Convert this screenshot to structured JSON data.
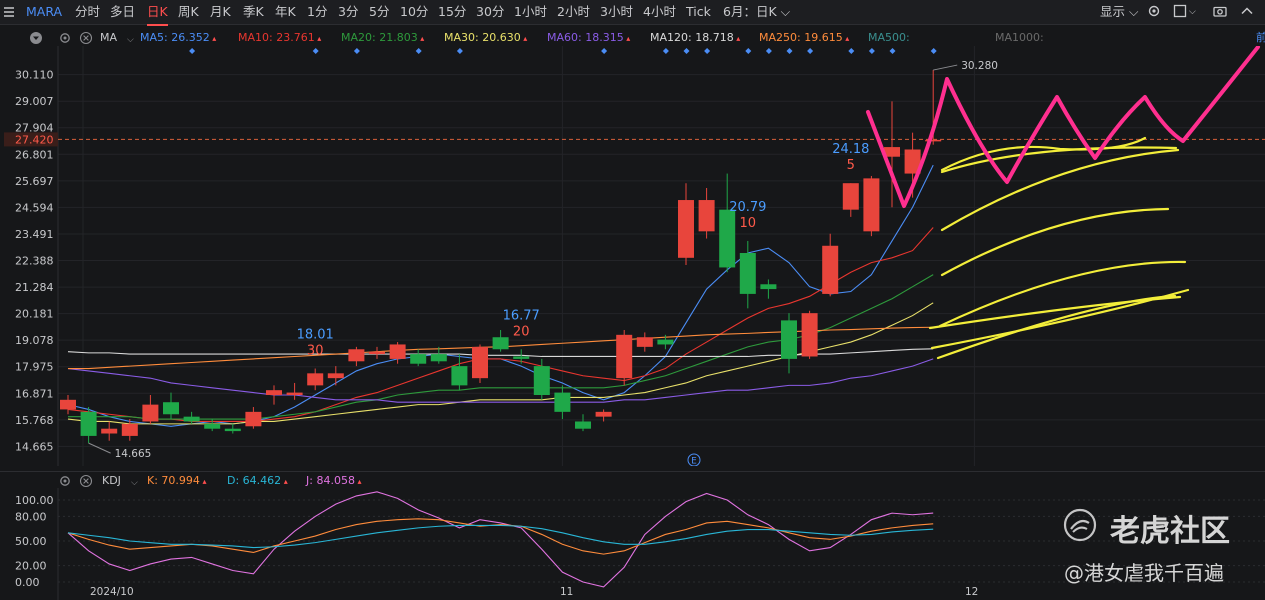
{
  "topbar": {
    "ticker": "MARA",
    "periods": [
      "分时",
      "多日",
      "日K",
      "周K",
      "月K",
      "季K",
      "年K",
      "1分",
      "3分",
      "5分",
      "10分",
      "15分",
      "30分",
      "1小时",
      "2小时",
      "3小时",
      "4小时",
      "Tick",
      "6月：日K"
    ],
    "active_period": "日K",
    "display_label": "显示"
  },
  "main_legend": {
    "indicator": "MA",
    "items": [
      {
        "label": "MA5:",
        "value": "26.352",
        "color": "#4b8df5"
      },
      {
        "label": "MA10:",
        "value": "23.761",
        "color": "#e8362f"
      },
      {
        "label": "MA20:",
        "value": "21.803",
        "color": "#2e9a3c"
      },
      {
        "label": "MA30:",
        "value": "20.630",
        "color": "#e8e06a"
      },
      {
        "label": "MA60:",
        "value": "18.315",
        "color": "#8a5ce6"
      },
      {
        "label": "MA120:",
        "value": "18.718",
        "color": "#d9d9d9"
      },
      {
        "label": "MA250:",
        "value": "19.615",
        "color": "#ff8c3c"
      },
      {
        "label": "MA500:",
        "value": "",
        "color": "#3a8f8f"
      },
      {
        "label": "MA1000:",
        "value": "",
        "color": "#6a6a6a"
      }
    ]
  },
  "kdj_legend": {
    "indicator": "KDJ",
    "items": [
      {
        "label": "K:",
        "value": "70.994",
        "color": "#ff8c3c"
      },
      {
        "label": "D:",
        "value": "64.462",
        "color": "#29b6d6"
      },
      {
        "label": "J:",
        "value": "84.058",
        "color": "#e073e0"
      }
    ]
  },
  "current_price": "27.420",
  "edge_label": "前",
  "event_marker": "E",
  "chart_data": {
    "type": "candlestick",
    "y_ticks": [
      30.11,
      29.007,
      27.904,
      26.801,
      25.697,
      24.594,
      23.491,
      22.388,
      21.284,
      20.181,
      19.078,
      17.975,
      16.871,
      15.768,
      14.665
    ],
    "y_range": [
      13.85,
      31.3
    ],
    "x_labels": [
      "2024/10",
      "11",
      "12"
    ],
    "candles": [
      {
        "o": 16.2,
        "h": 16.8,
        "l": 16.0,
        "c": 16.6
      },
      {
        "o": 16.1,
        "h": 16.3,
        "l": 14.8,
        "c": 15.1
      },
      {
        "o": 15.2,
        "h": 15.7,
        "l": 14.9,
        "c": 15.4
      },
      {
        "o": 15.1,
        "h": 15.8,
        "l": 14.9,
        "c": 15.6
      },
      {
        "o": 15.7,
        "h": 16.8,
        "l": 15.6,
        "c": 16.4
      },
      {
        "o": 16.5,
        "h": 16.9,
        "l": 15.8,
        "c": 16.0
      },
      {
        "o": 15.9,
        "h": 16.1,
        "l": 15.6,
        "c": 15.7
      },
      {
        "o": 15.6,
        "h": 15.8,
        "l": 15.3,
        "c": 15.4
      },
      {
        "o": 15.4,
        "h": 15.6,
        "l": 15.2,
        "c": 15.3
      },
      {
        "o": 15.5,
        "h": 16.3,
        "l": 15.4,
        "c": 16.1
      },
      {
        "o": 16.8,
        "h": 17.2,
        "l": 16.4,
        "c": 17.0
      },
      {
        "o": 16.8,
        "h": 17.3,
        "l": 16.6,
        "c": 16.9
      },
      {
        "o": 17.2,
        "h": 17.9,
        "l": 17.0,
        "c": 17.7
      },
      {
        "o": 17.5,
        "h": 18.0,
        "l": 17.2,
        "c": 17.7
      },
      {
        "o": 18.2,
        "h": 18.8,
        "l": 18.0,
        "c": 18.7
      },
      {
        "o": 18.5,
        "h": 18.8,
        "l": 18.3,
        "c": 18.6
      },
      {
        "o": 18.3,
        "h": 19.0,
        "l": 18.1,
        "c": 18.9
      },
      {
        "o": 18.5,
        "h": 18.7,
        "l": 18.0,
        "c": 18.1
      },
      {
        "o": 18.5,
        "h": 18.8,
        "l": 18.1,
        "c": 18.2
      },
      {
        "o": 18.0,
        "h": 18.5,
        "l": 17.0,
        "c": 17.2
      },
      {
        "o": 17.5,
        "h": 18.9,
        "l": 17.3,
        "c": 18.8
      },
      {
        "o": 19.2,
        "h": 19.5,
        "l": 18.6,
        "c": 18.7
      },
      {
        "o": 18.4,
        "h": 18.7,
        "l": 18.1,
        "c": 18.3
      },
      {
        "o": 18.0,
        "h": 18.3,
        "l": 16.6,
        "c": 16.8
      },
      {
        "o": 16.9,
        "h": 17.2,
        "l": 15.8,
        "c": 16.1
      },
      {
        "o": 15.7,
        "h": 16.0,
        "l": 15.3,
        "c": 15.4
      },
      {
        "o": 15.9,
        "h": 16.2,
        "l": 15.7,
        "c": 16.1
      },
      {
        "o": 17.5,
        "h": 19.5,
        "l": 17.2,
        "c": 19.3
      },
      {
        "o": 18.8,
        "h": 19.4,
        "l": 18.6,
        "c": 19.2
      },
      {
        "o": 19.1,
        "h": 19.3,
        "l": 18.7,
        "c": 18.9
      },
      {
        "o": 22.5,
        "h": 25.6,
        "l": 22.2,
        "c": 24.9
      },
      {
        "o": 23.6,
        "h": 25.4,
        "l": 23.3,
        "c": 24.9
      },
      {
        "o": 24.5,
        "h": 26.0,
        "l": 21.9,
        "c": 22.1
      },
      {
        "o": 22.7,
        "h": 23.2,
        "l": 20.4,
        "c": 21.0
      },
      {
        "o": 21.4,
        "h": 21.6,
        "l": 20.8,
        "c": 21.2
      },
      {
        "o": 19.9,
        "h": 20.2,
        "l": 17.7,
        "c": 18.3
      },
      {
        "o": 18.4,
        "h": 20.3,
        "l": 18.3,
        "c": 20.2
      },
      {
        "o": 21.0,
        "h": 23.5,
        "l": 20.9,
        "c": 23.0
      },
      {
        "o": 24.5,
        "h": 25.6,
        "l": 24.2,
        "c": 25.6
      },
      {
        "o": 23.6,
        "h": 25.9,
        "l": 23.4,
        "c": 25.8
      },
      {
        "o": 26.7,
        "h": 29.0,
        "l": 24.6,
        "c": 27.1
      },
      {
        "o": 26.0,
        "h": 27.7,
        "l": 25.0,
        "c": 27.0
      },
      {
        "o": 27.4,
        "h": 30.3,
        "l": 27.2,
        "c": 27.4
      }
    ],
    "ma": [
      {
        "name": "MA5",
        "color": "#4b8df5",
        "values": [
          16.4,
          16.2,
          15.9,
          15.7,
          15.6,
          15.5,
          15.6,
          15.7,
          15.6,
          15.7,
          15.9,
          16.3,
          16.8,
          17.3,
          17.8,
          18.1,
          18.3,
          18.4,
          18.5,
          18.4,
          18.3,
          18.3,
          18.0,
          17.6,
          17.3,
          16.9,
          16.6,
          16.9,
          17.6,
          18.4,
          19.8,
          21.2,
          22.0,
          22.7,
          22.9,
          22.3,
          21.3,
          21.0,
          21.1,
          21.8,
          23.2,
          24.6,
          26.35
        ]
      },
      {
        "name": "MA10",
        "color": "#e8362f",
        "values": [
          16.2,
          16.1,
          16.0,
          15.9,
          15.8,
          15.8,
          15.7,
          15.7,
          15.7,
          15.7,
          15.8,
          15.9,
          16.1,
          16.4,
          16.7,
          16.9,
          17.2,
          17.5,
          17.8,
          18.1,
          18.3,
          18.3,
          18.2,
          18.0,
          17.8,
          17.6,
          17.5,
          17.4,
          17.6,
          17.9,
          18.5,
          19.0,
          19.5,
          20.0,
          20.4,
          20.6,
          20.9,
          21.4,
          21.9,
          22.3,
          22.5,
          22.8,
          23.76
        ]
      },
      {
        "name": "MA20",
        "color": "#2e9a3c",
        "values": [
          15.9,
          15.9,
          15.9,
          15.9,
          15.8,
          15.8,
          15.8,
          15.8,
          15.8,
          15.8,
          15.9,
          16.0,
          16.1,
          16.3,
          16.5,
          16.6,
          16.8,
          16.9,
          17.0,
          17.0,
          17.1,
          17.1,
          17.1,
          17.1,
          17.1,
          17.1,
          17.1,
          17.2,
          17.4,
          17.6,
          17.9,
          18.2,
          18.5,
          18.8,
          19.0,
          19.1,
          19.3,
          19.6,
          20.0,
          20.4,
          20.8,
          21.3,
          21.8
        ]
      },
      {
        "name": "MA30",
        "color": "#e8e06a",
        "values": [
          15.8,
          15.7,
          15.7,
          15.6,
          15.6,
          15.6,
          15.6,
          15.6,
          15.6,
          15.7,
          15.7,
          15.8,
          15.9,
          16.0,
          16.1,
          16.2,
          16.3,
          16.4,
          16.4,
          16.5,
          16.6,
          16.6,
          16.6,
          16.6,
          16.7,
          16.7,
          16.7,
          16.8,
          16.9,
          17.1,
          17.3,
          17.6,
          17.8,
          18.0,
          18.2,
          18.4,
          18.6,
          18.8,
          19.0,
          19.3,
          19.7,
          20.1,
          20.63
        ]
      },
      {
        "name": "MA60",
        "color": "#8a5ce6",
        "values": [
          17.9,
          17.8,
          17.7,
          17.6,
          17.5,
          17.3,
          17.2,
          17.1,
          17.0,
          16.9,
          16.8,
          16.8,
          16.7,
          16.6,
          16.6,
          16.6,
          16.5,
          16.5,
          16.5,
          16.5,
          16.5,
          16.5,
          16.5,
          16.5,
          16.5,
          16.5,
          16.5,
          16.6,
          16.6,
          16.7,
          16.8,
          16.9,
          17.0,
          17.0,
          17.1,
          17.2,
          17.2,
          17.3,
          17.5,
          17.6,
          17.8,
          18.0,
          18.3
        ]
      },
      {
        "name": "MA120",
        "color": "#d9d9d9",
        "values": [
          18.6,
          18.55,
          18.55,
          18.5,
          18.5,
          18.5,
          18.5,
          18.5,
          18.5,
          18.5,
          18.5,
          18.5,
          18.5,
          18.5,
          18.5,
          18.5,
          18.5,
          18.5,
          18.5,
          18.5,
          18.45,
          18.45,
          18.45,
          18.4,
          18.4,
          18.4,
          18.4,
          18.4,
          18.4,
          18.4,
          18.4,
          18.4,
          18.4,
          18.4,
          18.45,
          18.45,
          18.5,
          18.5,
          18.55,
          18.6,
          18.65,
          18.7,
          18.72
        ]
      },
      {
        "name": "MA250",
        "color": "#ff8c3c",
        "values": [
          17.9,
          17.9,
          17.95,
          18.0,
          18.05,
          18.1,
          18.15,
          18.2,
          18.25,
          18.3,
          18.35,
          18.4,
          18.45,
          18.5,
          18.55,
          18.6,
          18.65,
          18.7,
          18.72,
          18.75,
          18.78,
          18.8,
          18.85,
          18.9,
          18.95,
          19.0,
          19.05,
          19.1,
          19.15,
          19.2,
          19.25,
          19.3,
          19.33,
          19.36,
          19.4,
          19.43,
          19.46,
          19.5,
          19.52,
          19.55,
          19.58,
          19.6,
          19.615
        ]
      }
    ],
    "annotations": [
      {
        "idx": 12,
        "price": "18.01",
        "days": "30"
      },
      {
        "idx": 22,
        "price": "16.77",
        "days": "20"
      },
      {
        "idx": 33,
        "price": "20.79",
        "days": "10"
      },
      {
        "idx": 38,
        "price": "24.18",
        "days": "5"
      }
    ],
    "low_label": "14.665",
    "high_label": "30.280",
    "kdj": {
      "y_ticks": [
        100.0,
        80.0,
        50.0,
        20.0,
        0.0
      ],
      "K": [
        60,
        52,
        45,
        40,
        42,
        44,
        46,
        44,
        40,
        36,
        44,
        50,
        56,
        64,
        70,
        74,
        76,
        77,
        76,
        72,
        68,
        70,
        68,
        58,
        46,
        38,
        34,
        38,
        48,
        58,
        64,
        72,
        74,
        70,
        66,
        60,
        54,
        52,
        56,
        62,
        66,
        69,
        70.994
      ],
      "D": [
        60,
        57,
        54,
        50,
        48,
        46,
        46,
        45,
        44,
        42,
        43,
        45,
        48,
        52,
        56,
        60,
        63,
        66,
        68,
        69,
        69,
        69,
        68,
        65,
        60,
        54,
        49,
        46,
        46,
        49,
        53,
        58,
        62,
        64,
        64,
        62,
        60,
        58,
        57,
        58,
        61,
        63,
        64.462
      ],
      "J": [
        60,
        38,
        22,
        14,
        22,
        28,
        30,
        22,
        14,
        10,
        40,
        62,
        80,
        95,
        105,
        110,
        102,
        88,
        78,
        66,
        76,
        72,
        66,
        40,
        12,
        0,
        -6,
        18,
        58,
        80,
        98,
        108,
        100,
        82,
        70,
        52,
        38,
        42,
        58,
        76,
        84,
        82,
        84.058
      ]
    }
  },
  "watermark": {
    "brand": "老虎社区",
    "handle": "@港女虐我千百遍"
  }
}
